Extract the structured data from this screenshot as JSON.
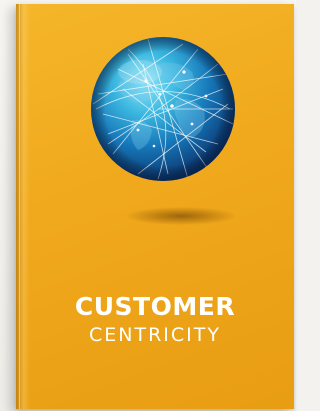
{
  "cover": {
    "title_line1": "CUSTOMER",
    "title_line2": "CENTRICITY",
    "globe_image": "network-globe-icon"
  },
  "colors": {
    "cover_background": "#f0a81c",
    "title_text": "#ffffff",
    "globe_primary": "#1e8fc4",
    "globe_dark": "#0b3f7a",
    "page_background": "#f4f2ee"
  }
}
